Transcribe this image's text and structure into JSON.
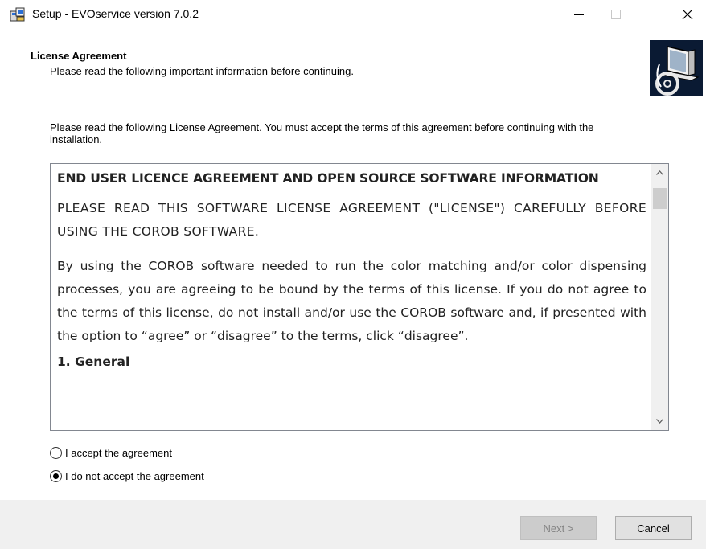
{
  "window": {
    "title": "Setup - EVOservice version 7.0.2",
    "app_icon": "setup-installer-icon",
    "controls": {
      "minimize": "—",
      "maximize": "☐",
      "close": "✕"
    }
  },
  "header": {
    "title": "License Agreement",
    "subtitle": "Please read the following important information before continuing.",
    "image": "wizard-computer-cd-icon"
  },
  "intro_text": "Please read the following License Agreement. You must accept the terms of this agreement before continuing with the installation.",
  "license": {
    "heading": "END USER LICENCE AGREEMENT AND OPEN SOURCE SOFTWARE INFORMATION",
    "paragraph1": "PLEASE READ THIS SOFTWARE LICENSE AGREEMENT (\"LICENSE\") CAREFULLY BEFORE USING THE COROB SOFTWARE.",
    "paragraph2": "By using the COROB software needed to run the color matching and/or color dispensing processes, you are agreeing to be bound by the terms of this license. If you do not agree to the terms of this license, do not install and/or use the COROB software and, if presented with the option to “agree” or “disagree” to the terms, click “disagree”.",
    "section1": "1. General"
  },
  "options": {
    "accept": {
      "label": "I accept the agreement",
      "checked": false
    },
    "decline": {
      "label": "I do not accept the agreement",
      "checked": true
    }
  },
  "buttons": {
    "next": "Next >",
    "cancel": "Cancel"
  },
  "colors": {
    "footer_bg": "#f0f0f0",
    "wizard_image_bg": "#0a1a33",
    "disabled_text": "#838383"
  }
}
